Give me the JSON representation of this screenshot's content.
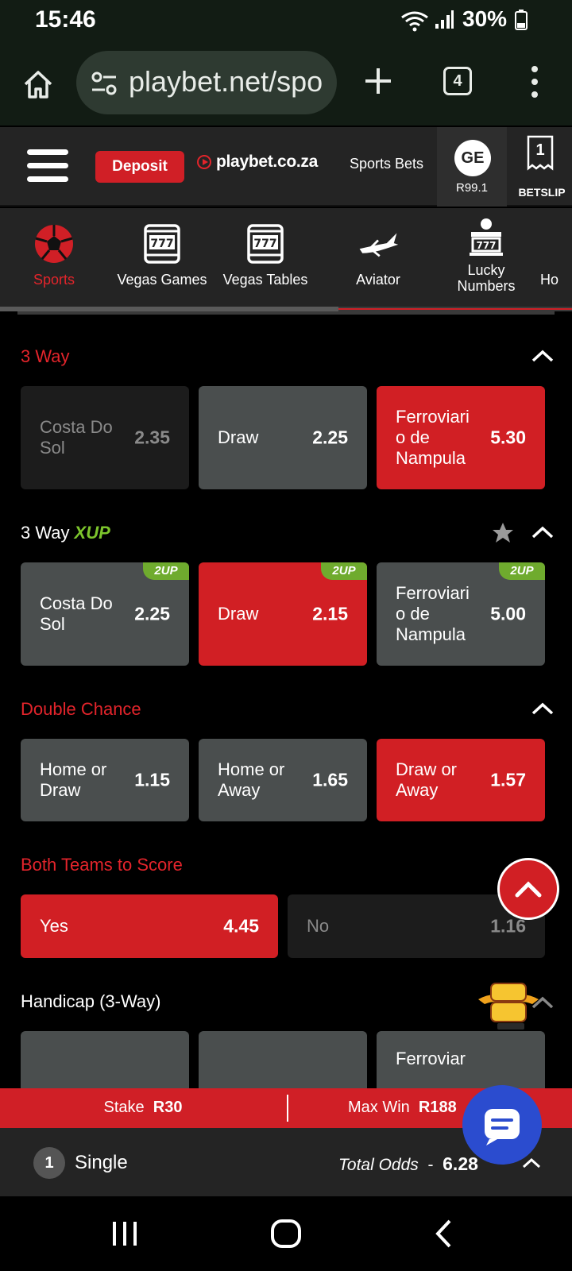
{
  "status_bar": {
    "time": "15:46",
    "battery": "30%"
  },
  "browser": {
    "url": "playbet.net/spo",
    "tab_count": "4"
  },
  "header": {
    "deposit": "Deposit",
    "logo": "playbet.co.za",
    "sports_bets": "Sports Bets",
    "avatar_initials": "GE",
    "balance": "R99.1",
    "betslip_count": "1",
    "betslip_label": "BETSLIP"
  },
  "categories": [
    {
      "label": "Sports",
      "icon": "soccer-ball-icon",
      "active": true
    },
    {
      "label": "Vegas Games",
      "icon": "slot-machine-icon"
    },
    {
      "label": "Vegas Tables",
      "icon": "slot-machine-icon"
    },
    {
      "label": "Aviator",
      "icon": "plane-icon"
    },
    {
      "label": "Lucky\nNumbers",
      "icon": "lottery-icon"
    },
    {
      "label": "Ho",
      "icon": ""
    }
  ],
  "markets": {
    "three_way": {
      "title": "3 Way",
      "options": [
        {
          "label": "Costa Do\nSol",
          "odds": "2.35"
        },
        {
          "label": "Draw",
          "odds": "2.25"
        },
        {
          "label": "Ferroviari\no de\nNampula",
          "odds": "5.30"
        }
      ]
    },
    "three_way_xup": {
      "title": "3 Way",
      "badge": "XUP",
      "tag": "2UP",
      "options": [
        {
          "label": "Costa Do\nSol",
          "odds": "2.25"
        },
        {
          "label": "Draw",
          "odds": "2.15"
        },
        {
          "label": "Ferroviari\no de\nNampula",
          "odds": "5.00"
        }
      ]
    },
    "double_chance": {
      "title": "Double Chance",
      "options": [
        {
          "label": "Home or\nDraw",
          "odds": "1.15"
        },
        {
          "label": "Home or\nAway",
          "odds": "1.65"
        },
        {
          "label": "Draw or\nAway",
          "odds": "1.57"
        }
      ]
    },
    "btts": {
      "title": "Both Teams to Score",
      "options": [
        {
          "label": "Yes",
          "odds": "4.45"
        },
        {
          "label": "No",
          "odds": "1.16"
        }
      ]
    },
    "handicap": {
      "title": "Handicap (3-Way)",
      "partial_label": "Ferroviar"
    }
  },
  "betbar": {
    "stake_label": "Stake",
    "stake_value": "R30",
    "maxwin_label": "Max Win",
    "maxwin_value": "R188",
    "count": "1",
    "type": "Single",
    "total_odds_label": "Total Odds",
    "total_odds_sep": "-",
    "total_odds": "6.28"
  },
  "colors": {
    "accent": "#d01f26",
    "tile": "#4a4e4e",
    "xup": "#7cc42c"
  }
}
